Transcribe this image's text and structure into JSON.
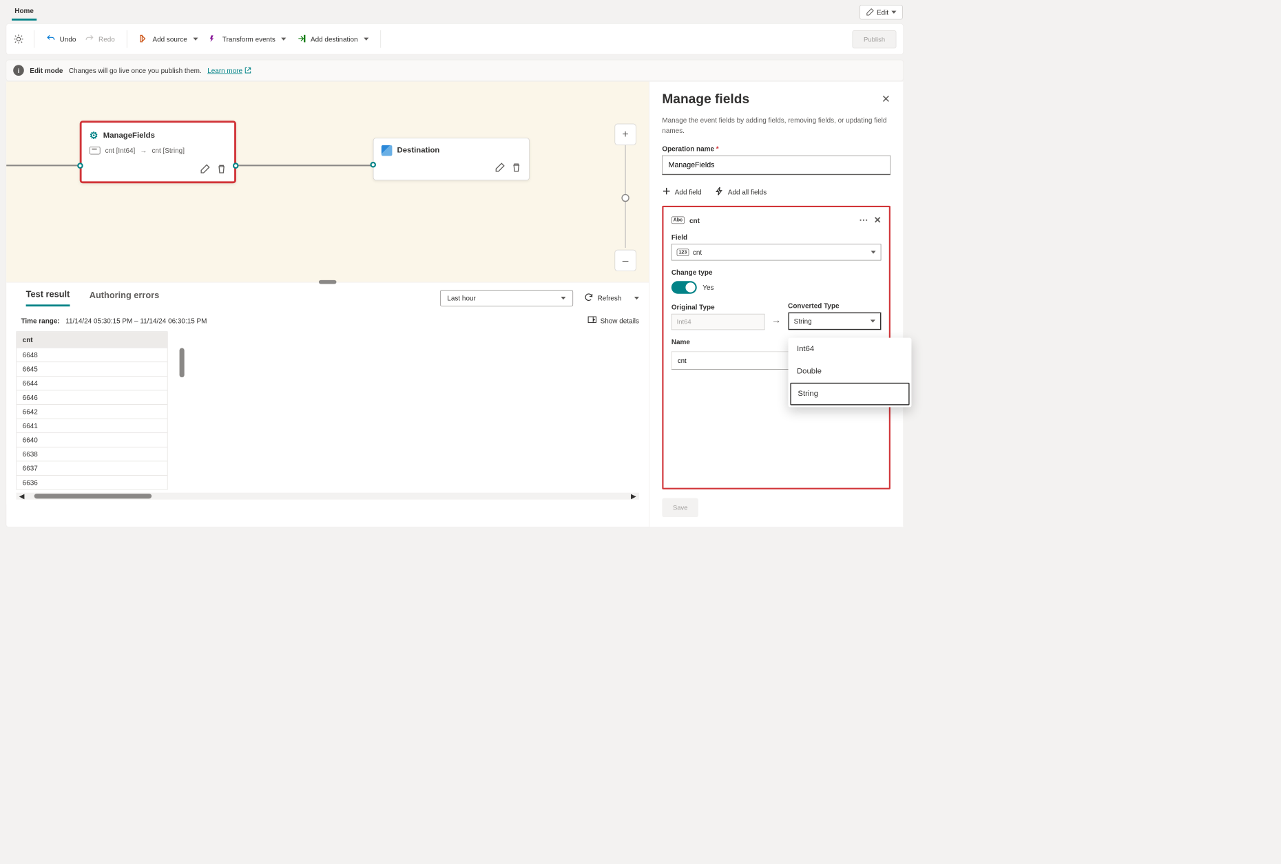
{
  "topbar": {
    "home_tab": "Home",
    "edit_button": "Edit"
  },
  "toolbar": {
    "undo": "Undo",
    "redo": "Redo",
    "add_source": "Add source",
    "transform": "Transform events",
    "add_dest": "Add destination",
    "publish": "Publish"
  },
  "infobar": {
    "mode": "Edit mode",
    "msg": "Changes will go live once you publish them.",
    "learn": "Learn more"
  },
  "canvas": {
    "mf_title": "ManageFields",
    "mf_from": "cnt [Int64]",
    "mf_to": "cnt [String]",
    "dest_title": "Destination"
  },
  "results": {
    "tab_result": "Test result",
    "tab_errors": "Authoring errors",
    "time_preset": "Last hour",
    "refresh": "Refresh",
    "time_range_label": "Time range:",
    "time_range_value": "11/14/24 05:30:15 PM  –  11/14/24 06:30:15 PM",
    "show_details": "Show details",
    "col": "cnt",
    "rows": [
      "6648",
      "6645",
      "6644",
      "6646",
      "6642",
      "6641",
      "6640",
      "6638",
      "6637",
      "6636"
    ]
  },
  "panel": {
    "title": "Manage fields",
    "desc": "Manage the event fields by adding fields, removing fields, or updating field names.",
    "opname_label": "Operation name",
    "opname_value": "ManageFields",
    "add_field": "Add field",
    "add_all": "Add all fields",
    "fc_name": "cnt",
    "field_label": "Field",
    "field_value": "cnt",
    "change_type_label": "Change type",
    "change_type_value": "Yes",
    "orig_type_label": "Original Type",
    "orig_type_value": "Int64",
    "conv_type_label": "Converted Type",
    "conv_type_value": "String",
    "name_label": "Name",
    "name_value": "cnt",
    "dd_int64": "Int64",
    "dd_double": "Double",
    "dd_string": "String",
    "save": "Save"
  }
}
